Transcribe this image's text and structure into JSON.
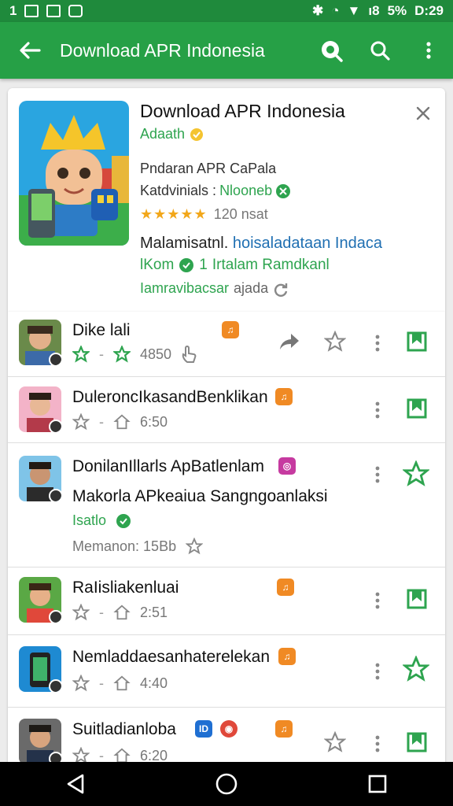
{
  "status_bar": {
    "left_text": "1",
    "battery_text": "5%",
    "signal_text": "ı8",
    "time": "D:29"
  },
  "app_bar": {
    "title": "Download APR Indonesia",
    "back_icon": "arrow-left-icon",
    "actions": [
      "settings-search-icon",
      "search-icon",
      "more-vert-icon"
    ]
  },
  "featured": {
    "title": "Download APR Indonesia",
    "subtitle": "Adaath",
    "info1": "Pndaran APR CaPala",
    "info2_label": "Katdvinials :",
    "info2_value": "Nlooneb",
    "stars": "★★★★★",
    "rating_count": "120 nsat",
    "desc_dark": "Malamisatnl.",
    "desc_blue": "hoisaladataan Indaca",
    "desc2_left": "lKom",
    "desc2_num": "1",
    "desc2_right": "Irtalam Ramdkanl",
    "desc3_green": "Iamravibacsar",
    "desc3_grey": "ajada"
  },
  "list": [
    {
      "title": "Dike lali",
      "meta": "4850",
      "tag": "#f08a24"
    },
    {
      "title": "DuleroncIkasandBenklikan",
      "meta": "6:50",
      "tag": "#f08a24"
    },
    {
      "title": "DonilanIllarls ApBatlenlam",
      "line2": "Makorla APkeaiua Sangngoanlaksi",
      "line3": "Isatlo",
      "line4": "Memanon: 15Bb",
      "tag": "#c63aa0"
    },
    {
      "title": "RaIisliakenluai",
      "meta": "2:51",
      "tag": "#f08a24"
    },
    {
      "title": "Nemladdaesanhaterelekan",
      "meta": "4:40",
      "tag": "#f08a24"
    },
    {
      "title": "Suitladianloba",
      "meta": "6:20",
      "tag": "#f08a24"
    }
  ],
  "colors": {
    "primary": "#26a046",
    "status": "#1f8a3c",
    "accent_green": "#2ea44f",
    "star": "#f2a71a"
  }
}
